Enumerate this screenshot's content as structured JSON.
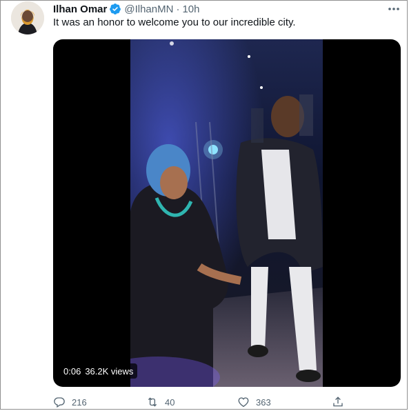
{
  "tweet": {
    "display_name": "Ilhan Omar",
    "handle": "@IlhanMN",
    "separator": "·",
    "time": "10h",
    "text": "It was an honor to welcome you to our incredible city.",
    "verified_icon": "verified-badge-icon",
    "more_icon": "more-options-icon"
  },
  "media": {
    "duration": "0:06",
    "views": "36.2K views"
  },
  "actions": {
    "replies": "216",
    "retweets": "40",
    "likes": "363",
    "reply_icon": "reply-icon",
    "retweet_icon": "retweet-icon",
    "like_icon": "heart-icon",
    "share_icon": "share-icon"
  },
  "colors": {
    "verified_blue": "#1d9bf0",
    "secondary_text": "#536471",
    "primary_text": "#0f1419"
  }
}
